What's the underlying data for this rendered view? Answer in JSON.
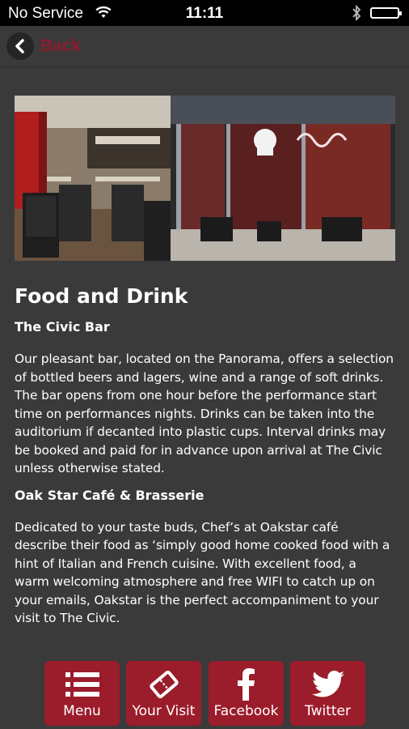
{
  "status_bar": {
    "carrier": "No Service",
    "time": "11:11",
    "icons": [
      "wifi-icon",
      "bluetooth-icon",
      "battery-icon"
    ]
  },
  "nav": {
    "back_label": "Back",
    "back_icon": "chevron-left-icon"
  },
  "hero": {
    "description_icon": "venue-photo"
  },
  "page": {
    "title": "Food and Drink",
    "sections": [
      {
        "heading": "The Civic Bar",
        "body": "Our pleasant bar, located on the Panorama, offers a selection of bottled beers and lagers, wine and a range of soft drinks. The bar opens from one hour before the performance start time on performances nights. Drinks can be taken into the auditorium if decanted into plastic cups. Interval drinks may be booked and paid for in advance upon arrival at The Civic unless otherwise stated."
      },
      {
        "heading": "Oak Star Café & Brasserie",
        "body": "Dedicated to your taste buds, Chef’s at Oakstar café describe their food as ‘simply good home cooked food with a hint of Italian and French cuisine. With excellent food, a warm welcoming atmosphere and free WIFI to catch up on your emails, Oakstar is the perfect accompaniment to your visit to The Civic."
      }
    ]
  },
  "tabs": [
    {
      "label": "Menu",
      "icon": "list-icon"
    },
    {
      "label": "Your Visit",
      "icon": "ticket-icon"
    },
    {
      "label": "Facebook",
      "icon": "facebook-icon"
    },
    {
      "label": "Twitter",
      "icon": "twitter-icon"
    }
  ],
  "colors": {
    "accent": "#9b1c2b",
    "back_text": "#8c1d2c",
    "background": "#3a3a3a"
  }
}
